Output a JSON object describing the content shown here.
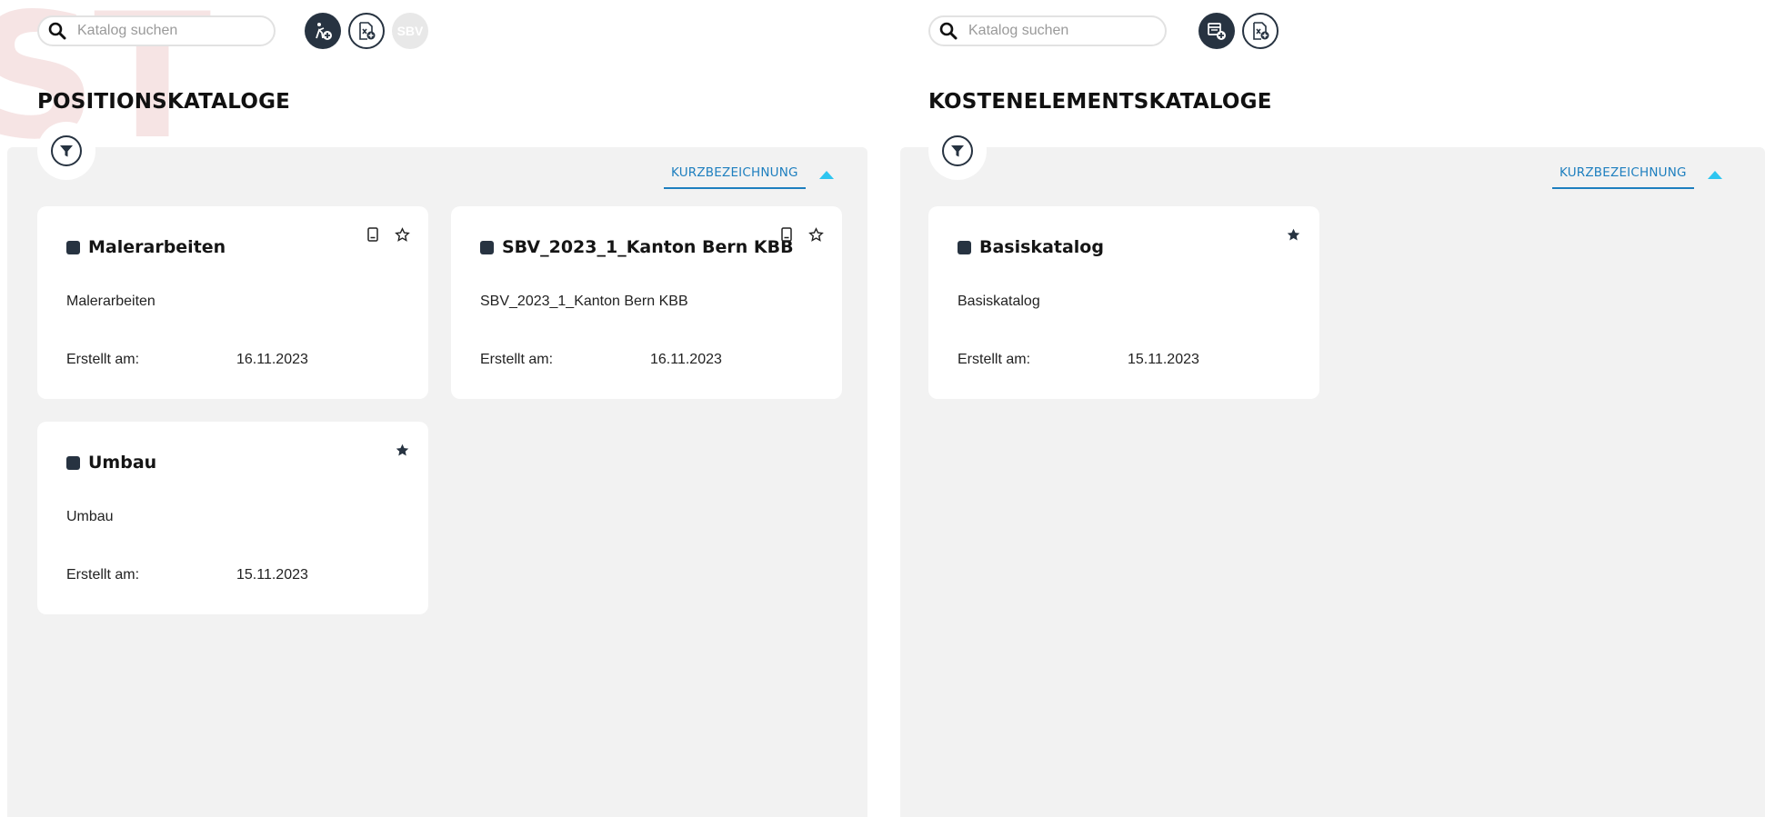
{
  "left": {
    "search": {
      "placeholder": "Katalog suchen"
    },
    "toolbar": {
      "sbv_label": "SBV"
    },
    "title": "POSITIONSKATALOGE",
    "sort": {
      "label": "KURZBEZEICHNUNG",
      "direction": "ascending"
    },
    "cards": [
      {
        "name": "Malerarbeiten",
        "description": "Malerarbeiten",
        "created_label": "Erstellt am:",
        "created_date": "16.11.2023",
        "has_device_icon": true,
        "favorite": false
      },
      {
        "name": "SBV_2023_1_Kanton Bern KBB",
        "description": "SBV_2023_1_Kanton Bern KBB",
        "created_label": "Erstellt am:",
        "created_date": "16.11.2023",
        "has_device_icon": true,
        "favorite": false
      },
      {
        "name": "Umbau",
        "description": "Umbau",
        "created_label": "Erstellt am:",
        "created_date": "15.11.2023",
        "has_device_icon": false,
        "favorite": true
      }
    ]
  },
  "right": {
    "search": {
      "placeholder": "Katalog suchen"
    },
    "title": "KOSTENELEMENTSKATALOGE",
    "sort": {
      "label": "KURZBEZEICHNUNG",
      "direction": "ascending"
    },
    "cards": [
      {
        "name": "Basiskatalog",
        "description": "Basiskatalog",
        "created_label": "Erstellt am:",
        "created_date": "15.11.2023",
        "has_device_icon": false,
        "favorite": true
      }
    ]
  },
  "watermark": "ST",
  "colors": {
    "primary_dark": "#273341",
    "accent_blue": "#1e7fbf",
    "sort_arrow": "#2ec5f0",
    "panel_bg": "#f2f2f2"
  },
  "icons": [
    "search-icon",
    "add-position-catalog-icon",
    "import-excel-icon",
    "add-cost-element-catalog-icon",
    "filter-icon",
    "sort-up-icon",
    "device-icon",
    "star-outline-icon",
    "star-filled-icon"
  ]
}
